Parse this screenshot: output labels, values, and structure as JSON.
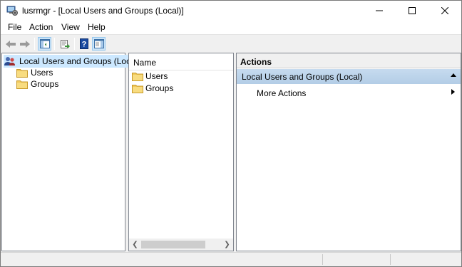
{
  "window": {
    "title": "lusrmgr - [Local Users and Groups (Local)]",
    "app_icon": "computer-management-icon",
    "controls": [
      "minimize-icon",
      "maximize-icon",
      "close-icon"
    ]
  },
  "menu": {
    "items": [
      {
        "label": "File"
      },
      {
        "label": "Action"
      },
      {
        "label": "View"
      },
      {
        "label": "Help"
      }
    ]
  },
  "toolbar": {
    "buttons": [
      "back-arrow-icon",
      "forward-arrow-icon",
      "show-hide-console-tree-icon",
      "export-list-icon",
      "help-icon",
      "show-hide-action-pane-icon"
    ]
  },
  "tree": {
    "root_label": "Local Users and Groups (Local)",
    "children": [
      {
        "label": "Users"
      },
      {
        "label": "Groups"
      }
    ]
  },
  "list": {
    "column_header": "Name",
    "items": [
      {
        "label": "Users"
      },
      {
        "label": "Groups"
      }
    ]
  },
  "actions": {
    "header": "Actions",
    "group_label": "Local Users and Groups (Local)",
    "more_actions": "More Actions"
  },
  "colors": {
    "selection": "#cce8ff",
    "actions_group": "#c6dbef",
    "folder": "#f0c85a"
  }
}
